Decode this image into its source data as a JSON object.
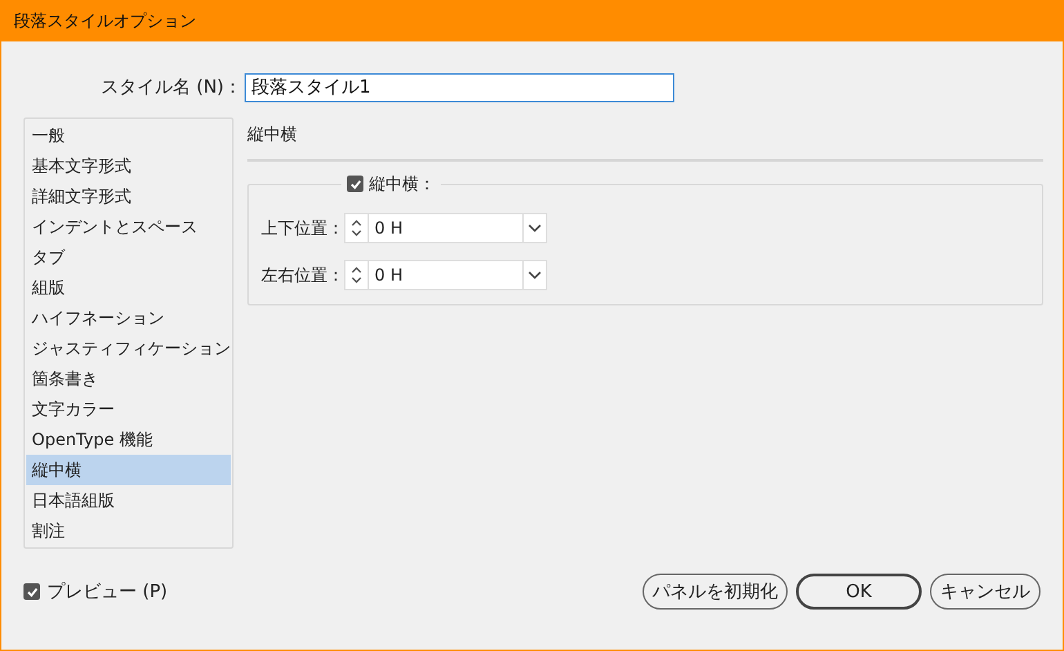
{
  "window": {
    "title": "段落スタイルオプション"
  },
  "style_name": {
    "label": "スタイル名 (N)：",
    "value": "段落スタイル1"
  },
  "sidebar": {
    "items": [
      {
        "label": "一般",
        "selected": false
      },
      {
        "label": "基本文字形式",
        "selected": false
      },
      {
        "label": "詳細文字形式",
        "selected": false
      },
      {
        "label": "インデントとスペース",
        "selected": false
      },
      {
        "label": "タブ",
        "selected": false
      },
      {
        "label": "組版",
        "selected": false
      },
      {
        "label": "ハイフネーション",
        "selected": false
      },
      {
        "label": "ジャスティフィケーション",
        "selected": false
      },
      {
        "label": "箇条書き",
        "selected": false
      },
      {
        "label": "文字カラー",
        "selected": false
      },
      {
        "label": "OpenType 機能",
        "selected": false
      },
      {
        "label": "縦中横",
        "selected": true
      },
      {
        "label": "日本語組版",
        "selected": false
      },
      {
        "label": "割注",
        "selected": false
      }
    ]
  },
  "panel": {
    "heading": "縦中横",
    "group": {
      "label": "縦中横：",
      "checked": true,
      "fields": [
        {
          "label": "上下位置：",
          "value": "0 H"
        },
        {
          "label": "左右位置：",
          "value": "0 H"
        }
      ]
    }
  },
  "preview": {
    "label": "プレビュー (P)",
    "checked": true
  },
  "buttons": [
    {
      "label": "パネルを初期化",
      "default": false
    },
    {
      "label": "OK",
      "default": true
    },
    {
      "label": "キャンセル",
      "default": false
    }
  ]
}
